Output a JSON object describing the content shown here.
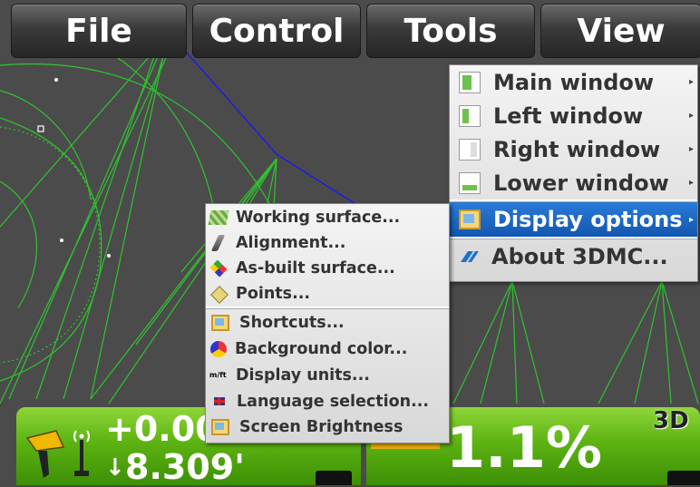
{
  "menubar": [
    "File",
    "Control",
    "Tools",
    "View"
  ],
  "view_menu": {
    "items": [
      {
        "label": "Main window",
        "icon": "main-window-icon",
        "submenu": true
      },
      {
        "label": "Left window",
        "icon": "left-window-icon",
        "submenu": true
      },
      {
        "label": "Right window",
        "icon": "right-window-icon",
        "submenu": true
      },
      {
        "label": "Lower window",
        "icon": "lower-window-icon",
        "submenu": true
      },
      {
        "label": "Display options",
        "icon": "display-options-icon",
        "submenu": true,
        "selected": true
      },
      {
        "label": "About 3DMC...",
        "icon": "3dmc-logo-icon",
        "submenu": false
      }
    ]
  },
  "display_options_menu": {
    "items": [
      {
        "label": "Working surface...",
        "icon": "working-surface-icon"
      },
      {
        "label": "Alignment...",
        "icon": "alignment-icon"
      },
      {
        "label": "As-built surface...",
        "icon": "as-built-surface-icon"
      },
      {
        "label": "Points...",
        "icon": "points-icon"
      },
      {
        "label": "Shortcuts...",
        "icon": "shortcuts-icon"
      },
      {
        "label": "Background color...",
        "icon": "background-color-icon"
      },
      {
        "label": "Display units...",
        "icon": "display-units-icon",
        "icon_text": "m/ft"
      },
      {
        "label": "Language selection...",
        "icon": "language-flag-icon"
      },
      {
        "label": "Screen Brightness",
        "icon": "screen-brightness-icon"
      }
    ]
  },
  "left_panel": {
    "value1": "+0.000",
    "value2": "8.309'"
  },
  "right_panel": {
    "slope": "1.1%",
    "mode_badge": "3D"
  },
  "colors": {
    "accent_green": "#5cb312",
    "selection_blue": "#1a66c4",
    "guide_line_green": "#29c429",
    "alignment_blue": "#1a1aff"
  }
}
